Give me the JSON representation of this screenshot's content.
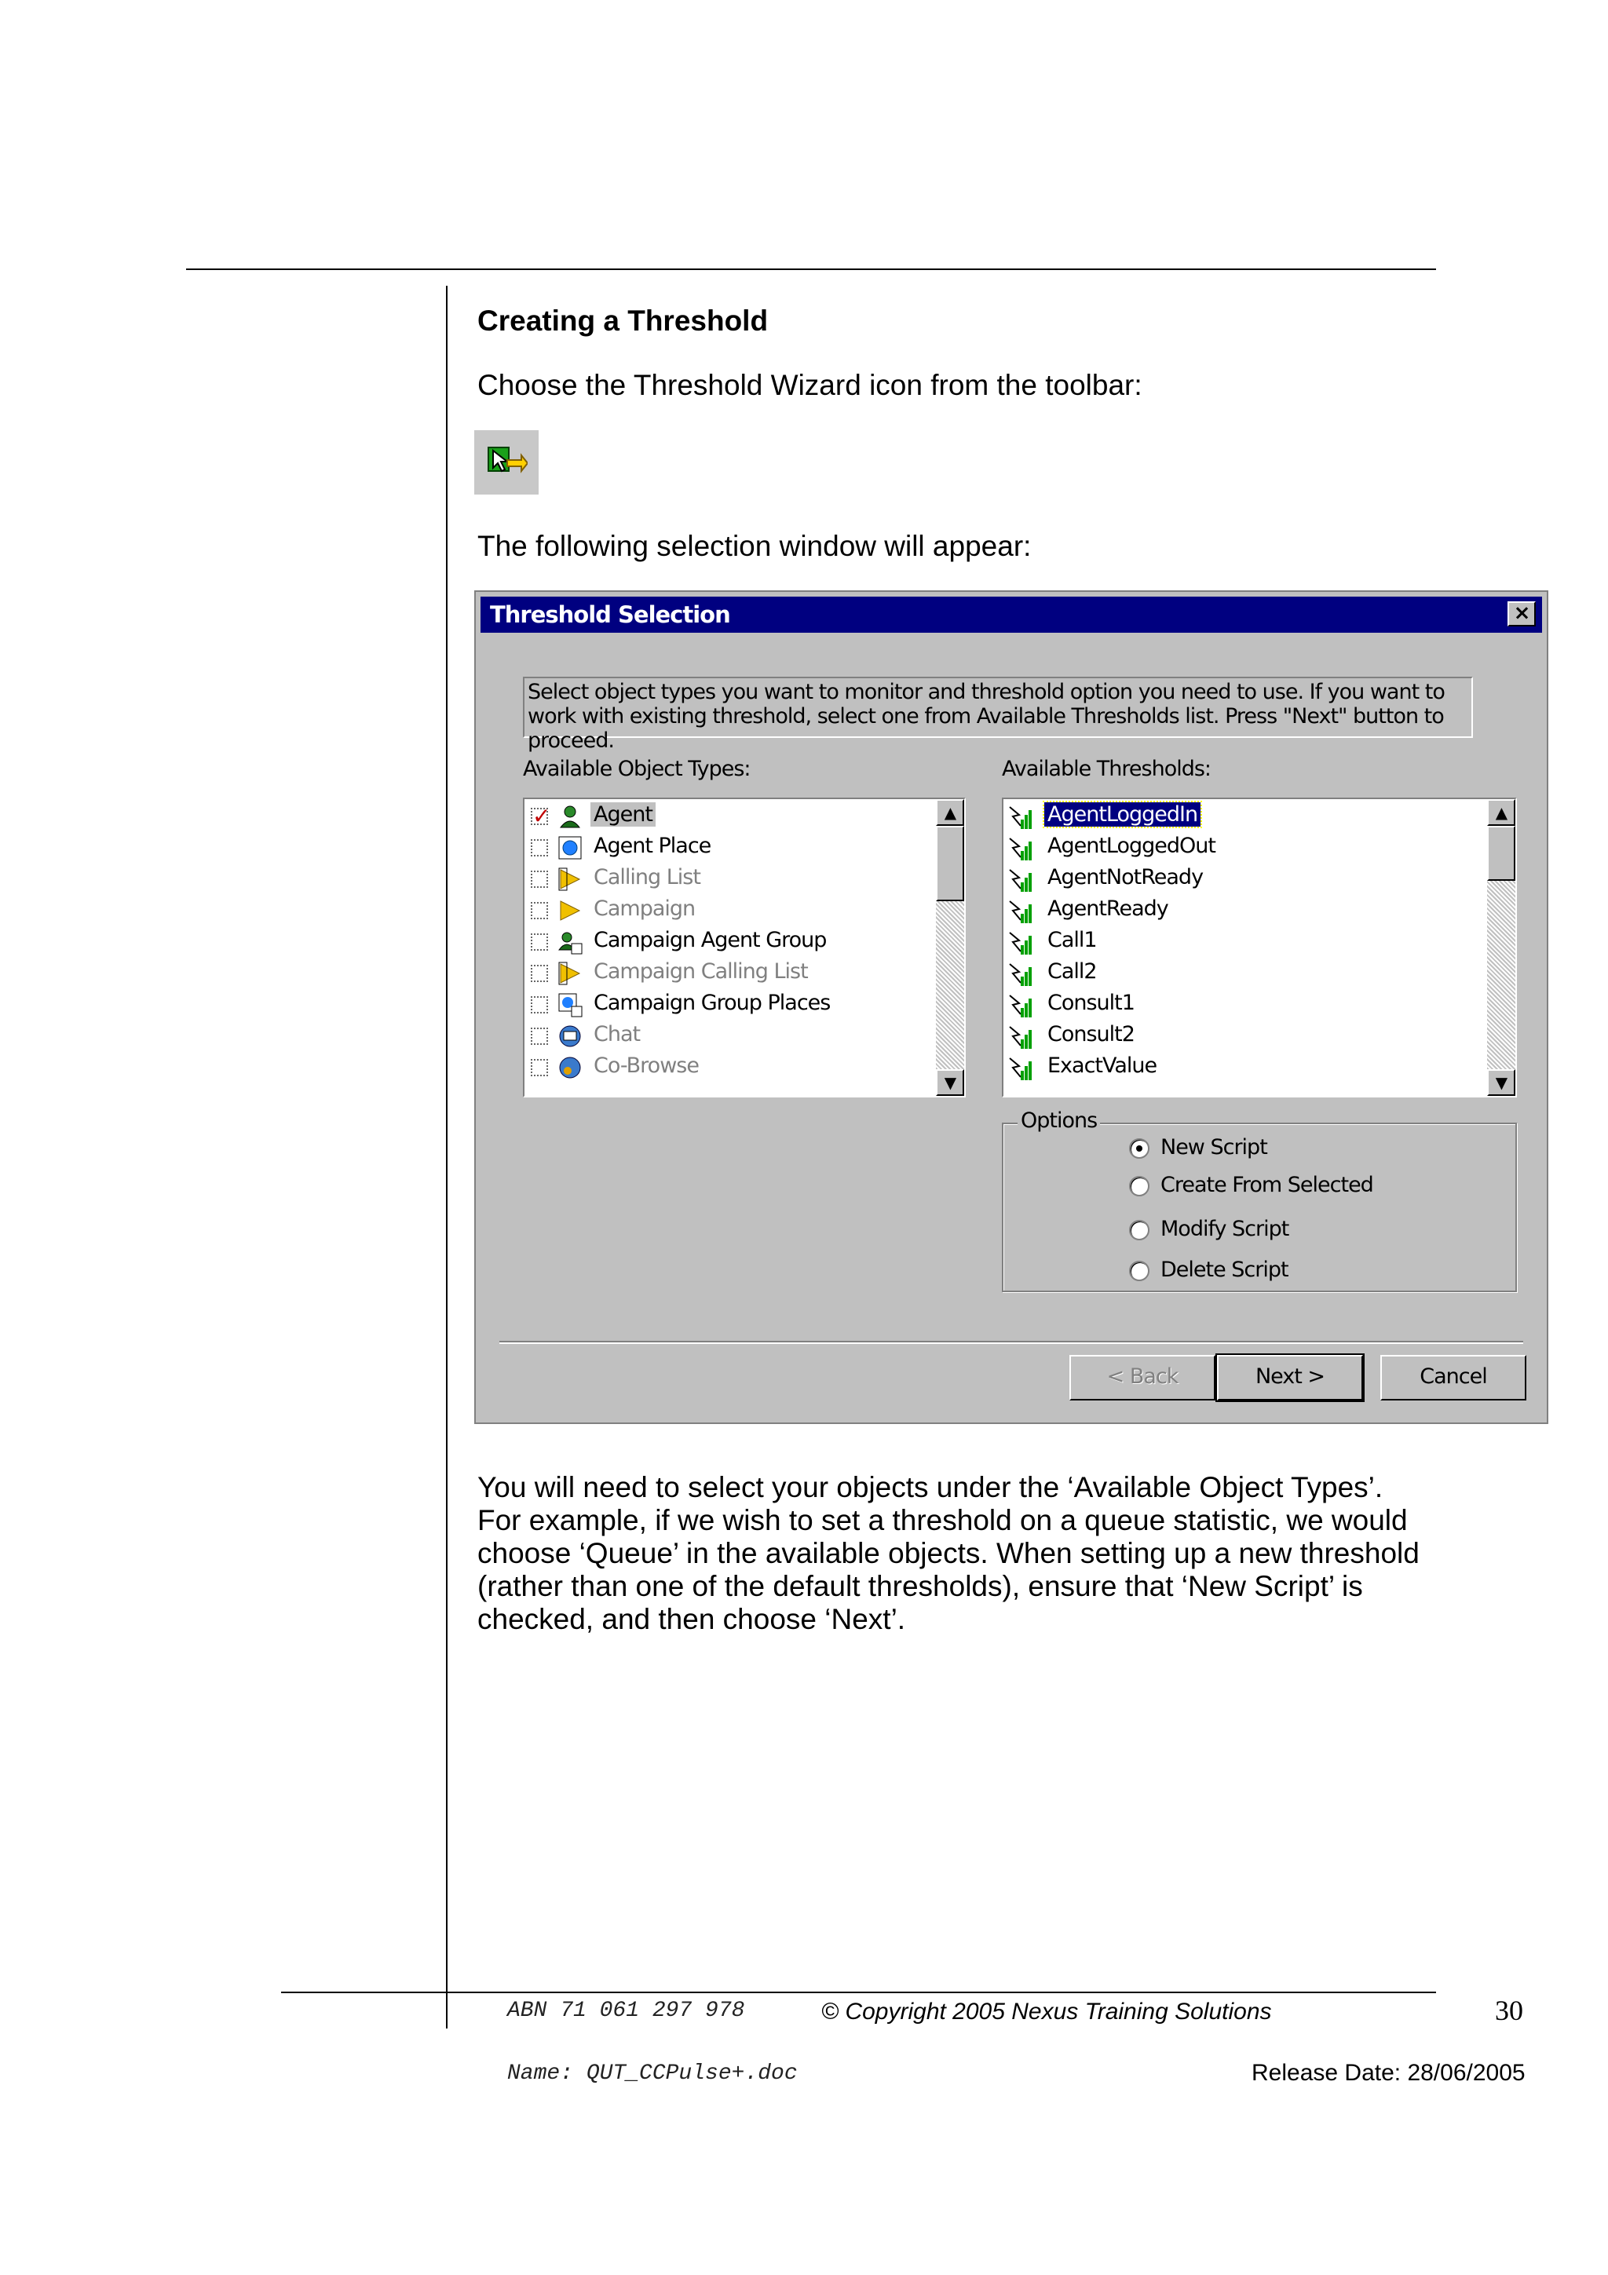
{
  "heading": "Creating a Threshold",
  "intro": "Choose the Threshold Wizard icon from the toolbar:",
  "selection_text": "The following selection window will appear:",
  "dialog": {
    "title": "Threshold Selection",
    "info": "Select object types you want to monitor and threshold option you need to use. If you want to work with existing threshold, select one from Available Thresholds list. Press \"Next\" button to proceed.",
    "object_types_label": "Available Object Types:",
    "thresholds_label": "Available Thresholds:",
    "object_types": [
      {
        "label": "Agent",
        "checked": true,
        "enabled": true,
        "selected": true,
        "icon": "agent-icon"
      },
      {
        "label": "Agent Place",
        "checked": false,
        "enabled": true,
        "icon": "place-icon"
      },
      {
        "label": "Calling List",
        "checked": false,
        "enabled": false,
        "icon": "calling-list-icon"
      },
      {
        "label": "Campaign",
        "checked": false,
        "enabled": false,
        "icon": "campaign-icon"
      },
      {
        "label": "Campaign Agent Group",
        "checked": false,
        "enabled": true,
        "icon": "campaign-agent-group-icon"
      },
      {
        "label": "Campaign Calling List",
        "checked": false,
        "enabled": false,
        "icon": "calling-list-icon"
      },
      {
        "label": "Campaign Group Places",
        "checked": false,
        "enabled": true,
        "icon": "campaign-group-places-icon"
      },
      {
        "label": "Chat",
        "checked": false,
        "enabled": false,
        "icon": "chat-icon"
      },
      {
        "label": "Co-Browse",
        "checked": false,
        "enabled": false,
        "icon": "co-browse-icon"
      }
    ],
    "thresholds": [
      {
        "label": "AgentLoggedIn",
        "selected": true
      },
      {
        "label": "AgentLoggedOut"
      },
      {
        "label": "AgentNotReady"
      },
      {
        "label": "AgentReady"
      },
      {
        "label": "Call1"
      },
      {
        "label": "Call2"
      },
      {
        "label": "Consult1"
      },
      {
        "label": "Consult2"
      },
      {
        "label": "ExactValue"
      }
    ],
    "options_label": "Options",
    "options": [
      {
        "label": "New Script",
        "selected": true
      },
      {
        "label": "Create From Selected",
        "selected": false
      },
      {
        "label": "Modify Script",
        "selected": false
      },
      {
        "label": "Delete Script",
        "selected": false
      }
    ],
    "buttons": {
      "back": "< Back",
      "next": "Next >",
      "cancel": "Cancel"
    }
  },
  "body_text": "You will need to select your objects under the ‘Available Object Types’. For example, if we wish to set a threshold on a queue statistic, we would choose ‘Queue’ in the available objects.  When setting up a new threshold (rather than one of the default thresholds), ensure that ‘New Script’ is checked, and then choose ‘Next’.",
  "footer": {
    "abn": "ABN 71 061 297 978",
    "copyright": "© Copyright 2005 Nexus Training Solutions",
    "page_number": "30",
    "name": "Name: QUT_CCPulse+.doc",
    "release_date": "Release Date: 28/06/2005"
  }
}
